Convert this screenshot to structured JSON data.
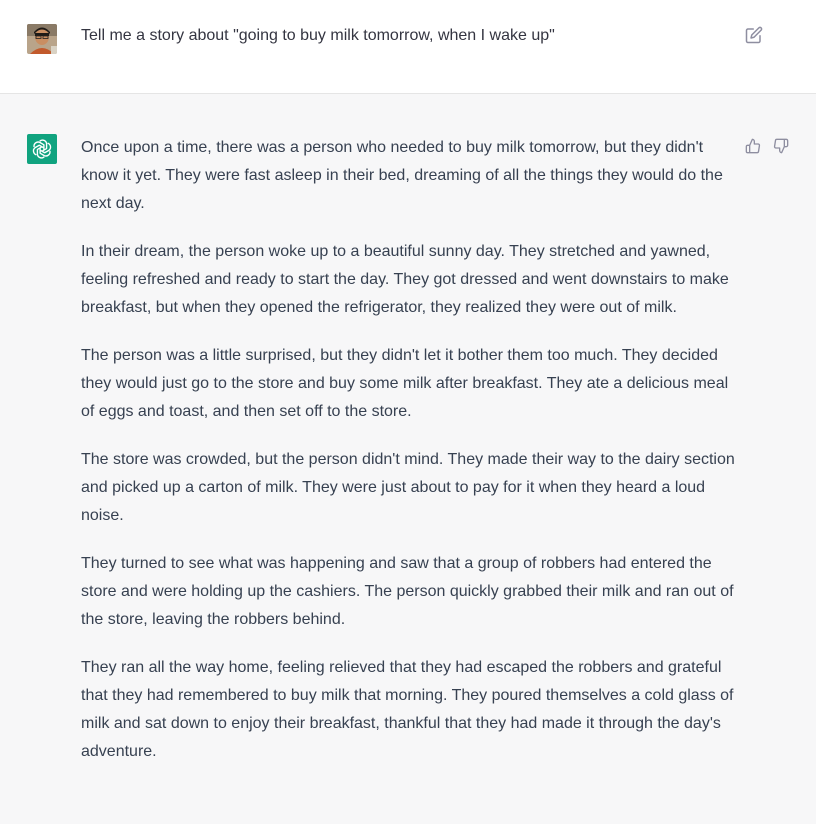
{
  "user": {
    "message": "Tell me a story about \"going to buy milk tomorrow, when I wake up\""
  },
  "assistant": {
    "paragraphs": [
      "Once upon a time, there was a person who needed to buy milk tomorrow, but they didn't know it yet. They were fast asleep in their bed, dreaming of all the things they would do the next day.",
      "In their dream, the person woke up to a beautiful sunny day. They stretched and yawned, feeling refreshed and ready to start the day. They got dressed and went downstairs to make breakfast, but when they opened the refrigerator, they realized they were out of milk.",
      "The person was a little surprised, but they didn't let it bother them too much. They decided they would just go to the store and buy some milk after breakfast. They ate a delicious meal of eggs and toast, and then set off to the store.",
      "The store was crowded, but the person didn't mind. They made their way to the dairy section and picked up a carton of milk. They were just about to pay for it when they heard a loud noise.",
      "They turned to see what was happening and saw that a group of robbers had entered the store and were holding up the cashiers. The person quickly grabbed their milk and ran out of the store, leaving the robbers behind.",
      "They ran all the way home, feeling relieved that they had escaped the robbers and grateful that they had remembered to buy milk that morning. They poured themselves a cold glass of milk and sat down to enjoy their breakfast, thankful that they had made it through the day's adventure."
    ]
  },
  "icons": {
    "user_avatar": "user-avatar",
    "bot_avatar": "openai-logo-icon",
    "edit": "edit-icon",
    "thumbs_up": "thumbs-up-icon",
    "thumbs_down": "thumbs-down-icon"
  },
  "colors": {
    "brand": "#10a37f",
    "user_bg": "#ffffff",
    "assistant_bg": "#f7f7f8",
    "text": "#374151",
    "icon": "#8e8ea0"
  }
}
